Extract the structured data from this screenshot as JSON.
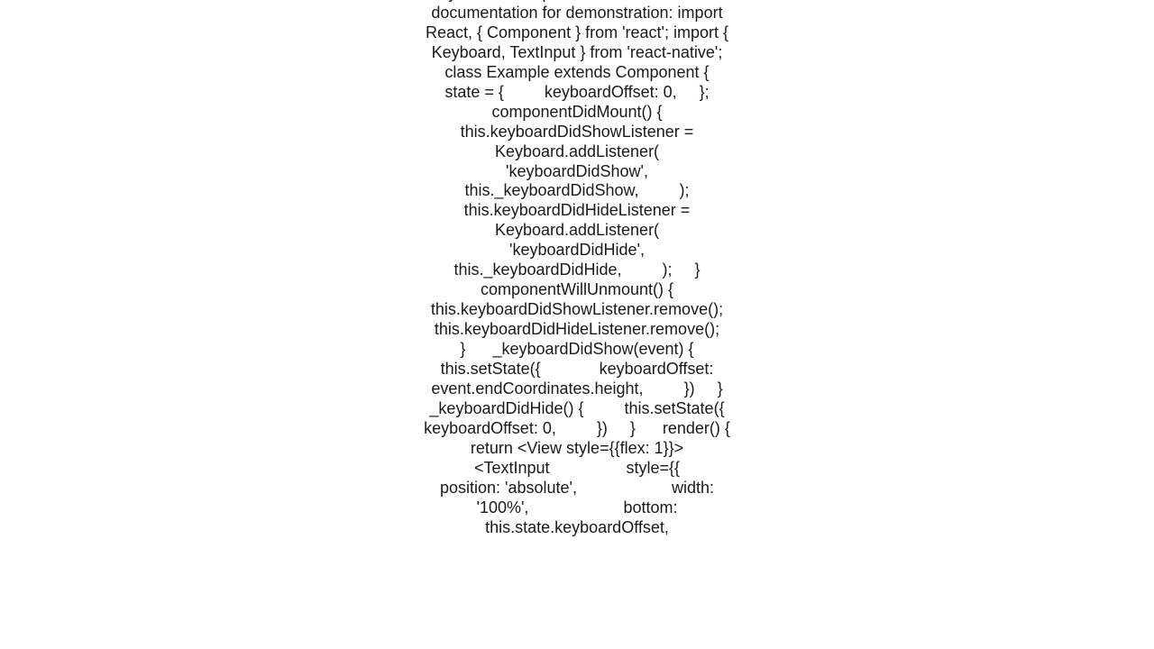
{
  "document": {
    "body_text": "events.  Here is a modification of the Keyboard example from the React Native documentation for demonstration: import React, { Component } from 'react'; import { Keyboard, TextInput } from 'react-native';  class Example extends Component {      state = {         keyboardOffset: 0,     };      componentDidMount() {         this.keyboardDidShowListener = Keyboard.addListener(             'keyboardDidShow',             this._keyboardDidShow,         );         this.keyboardDidHideListener = Keyboard.addListener(             'keyboardDidHide',             this._keyboardDidHide,         );     }      componentWillUnmount() {         this.keyboardDidShowListener.remove();         this.keyboardDidHideListener.remove();     }      _keyboardDidShow(event) {         this.setState({             keyboardOffset: event.endCoordinates.height,         })     }      _keyboardDidHide() {         this.setState({             keyboardOffset: 0,         })     }      render() {         return <View style={{flex: 1}}>             <TextInput                 style={{                     position: 'absolute',                     width:    '100%',                     bottom:   this.state.keyboardOffset,"
  }
}
